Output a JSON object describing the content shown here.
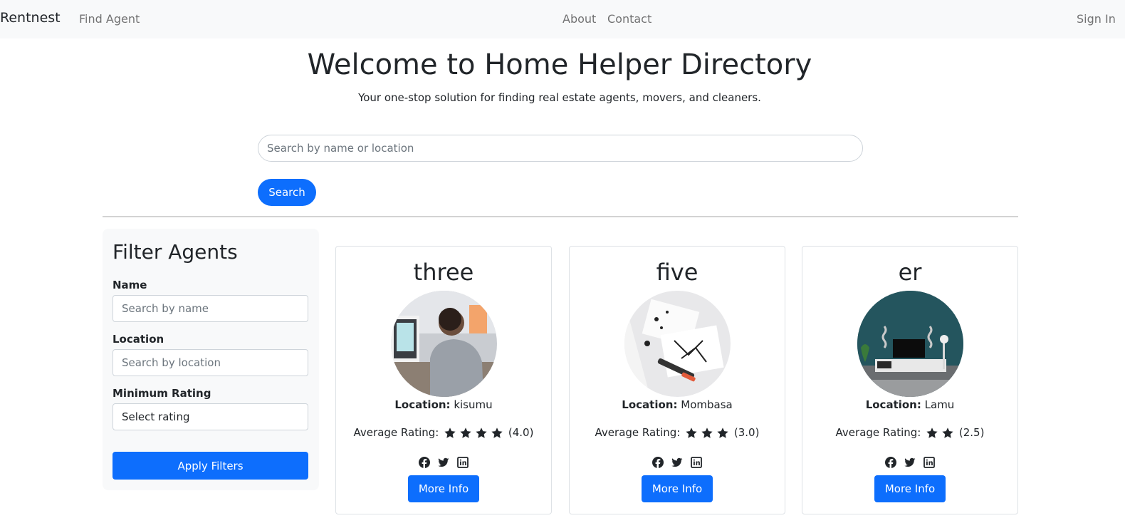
{
  "nav": {
    "brand": "Rentnest",
    "find_agent": "Find Agent",
    "about": "About",
    "contact": "Contact",
    "sign_in": "Sign In"
  },
  "hero": {
    "title": "Welcome to Home Helper Directory",
    "subtitle": "Your one-stop solution for finding real estate agents, movers, and cleaners."
  },
  "search": {
    "placeholder": "Search by name or location",
    "button_label": "Search"
  },
  "filter": {
    "title": "Filter Agents",
    "name_label": "Name",
    "name_placeholder": "Search by name",
    "location_label": "Location",
    "location_placeholder": "Search by location",
    "rating_label": "Minimum Rating",
    "rating_selected": "Select rating",
    "apply_label": "Apply Filters"
  },
  "agents": [
    {
      "name": "three",
      "location_label": "Location:",
      "location": "kisumu",
      "rating_label": "Average Rating:",
      "rating_value": 4,
      "rating_text": "(4.0)",
      "more_label": "More Info"
    },
    {
      "name": "five",
      "location_label": "Location:",
      "location": "Mombasa",
      "rating_label": "Average Rating:",
      "rating_value": 3,
      "rating_text": "(3.0)",
      "more_label": "More Info"
    },
    {
      "name": "er",
      "location_label": "Location:",
      "location": "Lamu",
      "rating_label": "Average Rating:",
      "rating_value": 2,
      "rating_text": "(2.5)",
      "more_label": "More Info"
    }
  ],
  "social_icons": [
    "facebook-icon",
    "twitter-icon",
    "linkedin-icon"
  ],
  "colors": {
    "primary": "#0d6efd",
    "navbar_bg": "#f8f9fa",
    "text": "#212529"
  }
}
